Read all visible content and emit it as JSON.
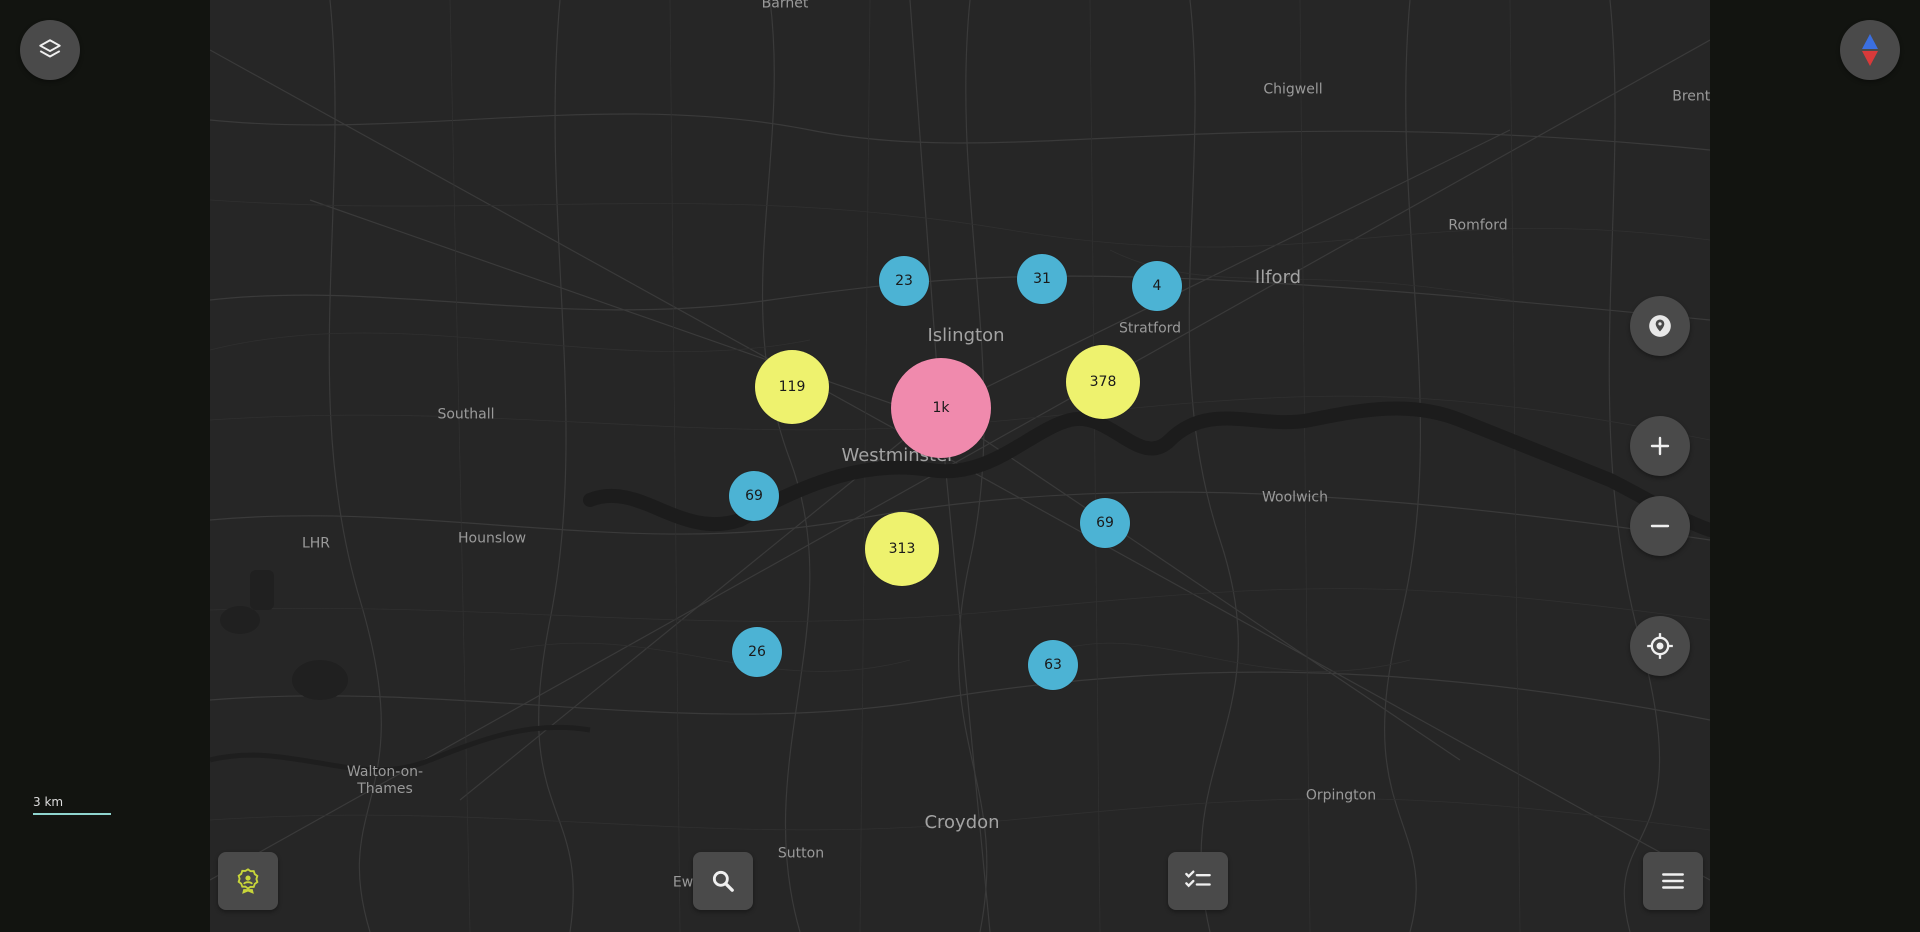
{
  "map": {
    "place_labels": [
      {
        "id": "barnet",
        "text": "Barnet",
        "size": "small"
      },
      {
        "id": "chigwell",
        "text": "Chigwell",
        "size": "small"
      },
      {
        "id": "brentwood",
        "text": "Brentw",
        "size": "small"
      },
      {
        "id": "romford",
        "text": "Romford",
        "size": "small"
      },
      {
        "id": "ilford",
        "text": "Ilford",
        "size": "big"
      },
      {
        "id": "stratford",
        "text": "Stratford",
        "size": "small"
      },
      {
        "id": "islington",
        "text": "Islington",
        "size": "big"
      },
      {
        "id": "westminster",
        "text": "Westminster",
        "size": "big"
      },
      {
        "id": "southall",
        "text": "Southall",
        "size": "small"
      },
      {
        "id": "hounslow",
        "text": "Hounslow",
        "size": "small"
      },
      {
        "id": "lhr",
        "text": "LHR",
        "size": "small"
      },
      {
        "id": "woolwich",
        "text": "Woolwich",
        "size": "small"
      },
      {
        "id": "walton",
        "text": "Walton-on-\nThames",
        "size": "small"
      },
      {
        "id": "croydon",
        "text": "Croydon",
        "size": "big"
      },
      {
        "id": "sutton",
        "text": "Sutton",
        "size": "small"
      },
      {
        "id": "orpington",
        "text": "Orpington",
        "size": "small"
      },
      {
        "id": "epsom",
        "text": "Ew",
        "size": "small"
      }
    ],
    "clusters": [
      {
        "id": "cluster-23",
        "count": "23",
        "tier": "blue"
      },
      {
        "id": "cluster-31",
        "count": "31",
        "tier": "blue"
      },
      {
        "id": "cluster-4",
        "count": "4",
        "tier": "blue"
      },
      {
        "id": "cluster-119",
        "count": "119",
        "tier": "yellow"
      },
      {
        "id": "cluster-1k",
        "count": "1k",
        "tier": "pink"
      },
      {
        "id": "cluster-378",
        "count": "378",
        "tier": "yellow"
      },
      {
        "id": "cluster-69-west",
        "count": "69",
        "tier": "blue"
      },
      {
        "id": "cluster-313",
        "count": "313",
        "tier": "yellow"
      },
      {
        "id": "cluster-69-east",
        "count": "69",
        "tier": "blue"
      },
      {
        "id": "cluster-26",
        "count": "26",
        "tier": "blue"
      },
      {
        "id": "cluster-63",
        "count": "63",
        "tier": "blue"
      }
    ],
    "scale_label": "3 km"
  },
  "controls": {
    "layers": "layers-icon",
    "compass": "compass-icon",
    "pin": "location-pin-icon",
    "zoom_in": "plus-icon",
    "zoom_out": "minus-icon",
    "locate": "crosshair-icon",
    "badge": "badge-icon",
    "search": "search-icon",
    "checklist": "checklist-icon",
    "menu": "menu-icon"
  },
  "colors": {
    "cluster_blue": "#4cb3d4",
    "cluster_yellow": "#eef26e",
    "cluster_pink": "#f08aad",
    "scale_bar": "#8fd5cf",
    "badge_accent": "#c8d63a"
  }
}
